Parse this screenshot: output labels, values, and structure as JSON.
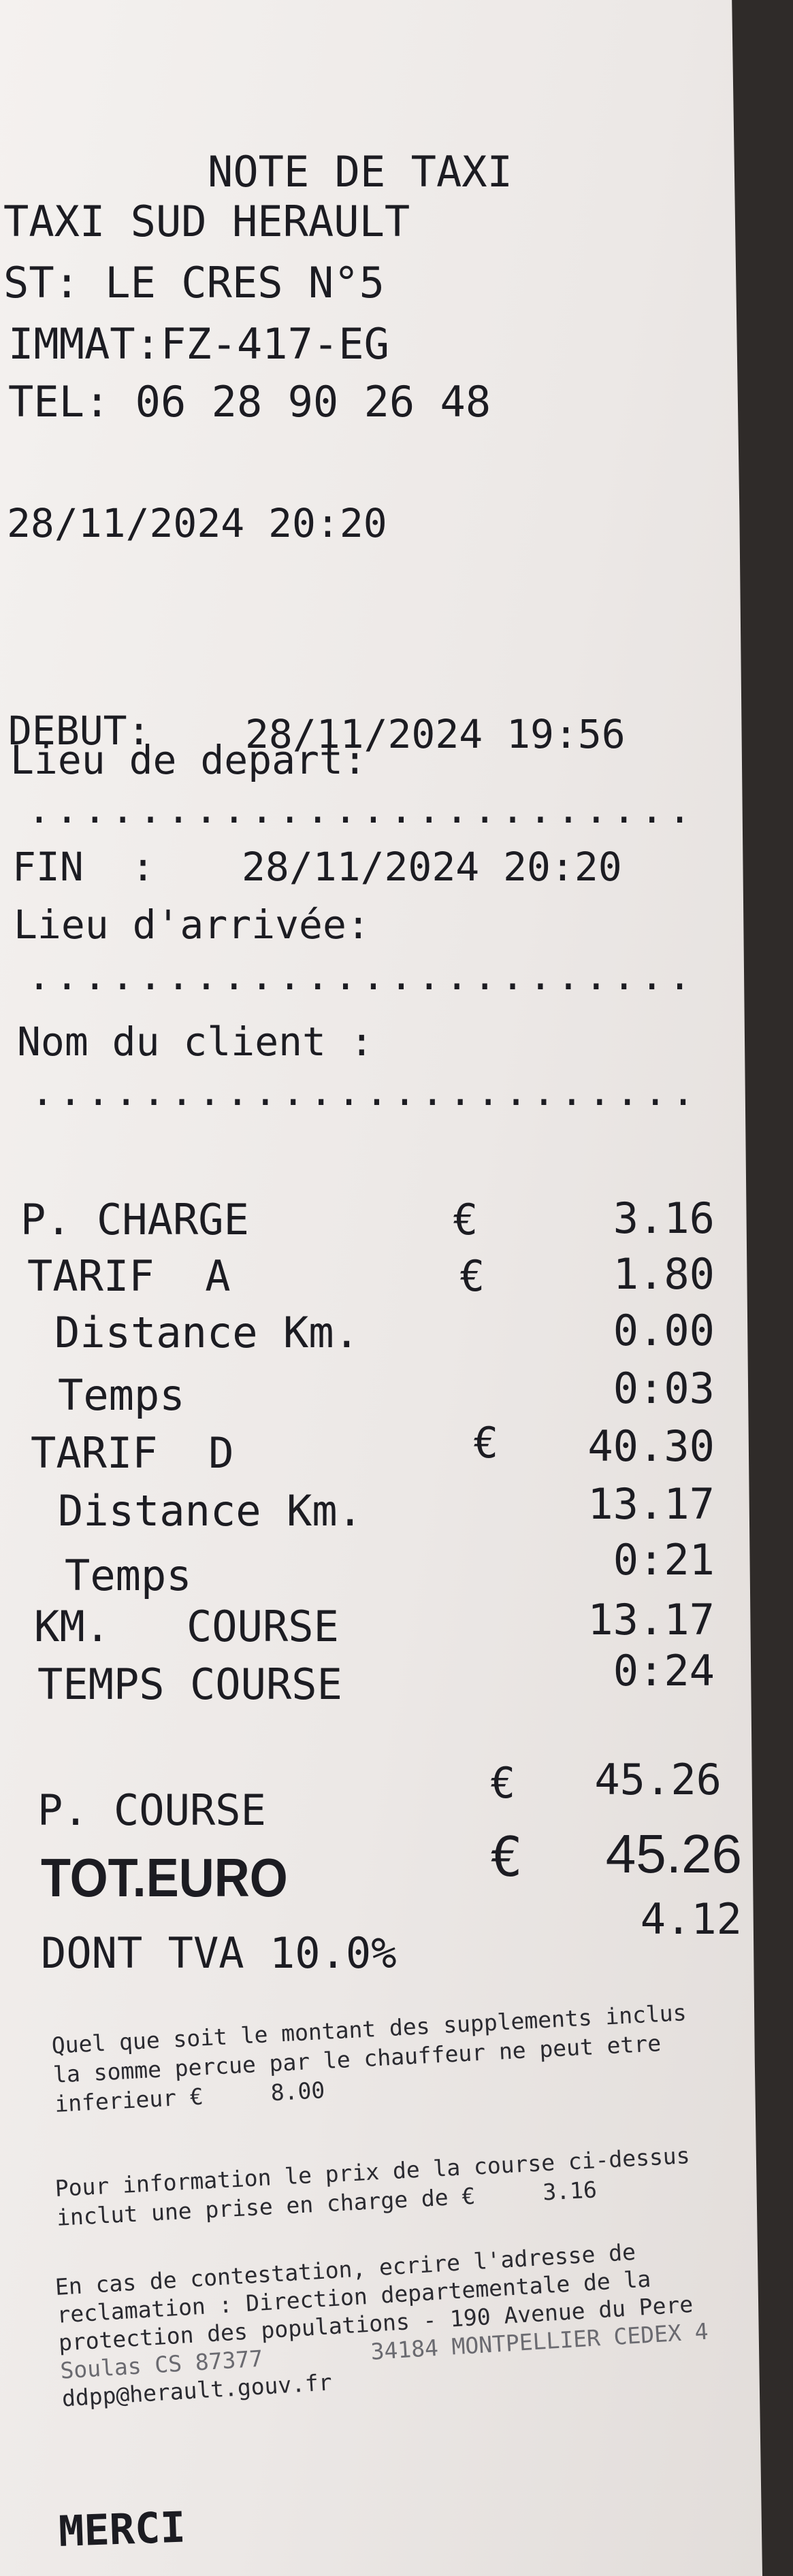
{
  "header": {
    "title": "NOTE DE TAXI",
    "company": "TAXI SUD HERAULT",
    "station": "ST: LE CRES N°5",
    "immat": "IMMAT:FZ-417-EG",
    "tel": "TEL: 06 28 90 26 48",
    "datetime": "28/11/2024 20:20"
  },
  "trip": {
    "start_label": "DEBUT:",
    "start_value": "28/11/2024 19:56",
    "departure_label": "Lieu de depart:",
    "departure_dots": "........................",
    "end_label": "FIN  :",
    "end_value": "28/11/2024 20:20",
    "arrival_label": "Lieu d'arrivée:",
    "arrival_dots": "........................",
    "client_label": "Nom du client :",
    "client_dots": "........................"
  },
  "lines": {
    "pcharge_label": "P. CHARGE",
    "pcharge_cur": "€",
    "pcharge_val": "3.16",
    "tarifa_label": "TARIF  A",
    "tarifa_cur": "€",
    "tarifa_val": "1.80",
    "dist_a_label": "Distance Km.",
    "dist_a_val": "0.00",
    "temps_a_label": "Temps",
    "temps_a_val": "0:03",
    "tarifd_label": "TARIF  D",
    "tarifd_cur": "€",
    "tarifd_val": "40.30",
    "dist_d_label": "Distance Km.",
    "dist_d_val": "13.17",
    "temps_d_label": "Temps",
    "temps_d_val": "0:21",
    "km_course_label": "KM.   COURSE",
    "km_course_val": "13.17",
    "temps_course_label": "TEMPS COURSE",
    "temps_course_val": "0:24"
  },
  "totals": {
    "pcourse_label": "P. COURSE",
    "pcourse_cur": "€",
    "pcourse_val": "45.26",
    "tot_label": "TOT.EURO",
    "tot_cur": "€",
    "tot_val": "45.26",
    "tva_label": "DONT TVA 10.0%",
    "tva_val": "4.12"
  },
  "footer": {
    "p1_l1": "Quel que soit le montant des supplements inclus",
    "p1_l2": "la somme percue par le chauffeur ne peut etre",
    "p1_l3": "inferieur €     8.00",
    "p2_l1": "Pour information le prix de la course ci-dessus",
    "p2_l2": "inclut une prise en charge de €     3.16",
    "p3_l1": "En cas de contestation, ecrire l'adresse de",
    "p3_l2": "reclamation : Direction departementale de la",
    "p3_l3": "protection des populations - 190 Avenue du Pere",
    "p3_l4": "Soulas CS 87377        34184 MONTPELLIER CEDEX 4",
    "email": "ddpp@herault.gouv.fr",
    "thanks": "MERCI"
  }
}
